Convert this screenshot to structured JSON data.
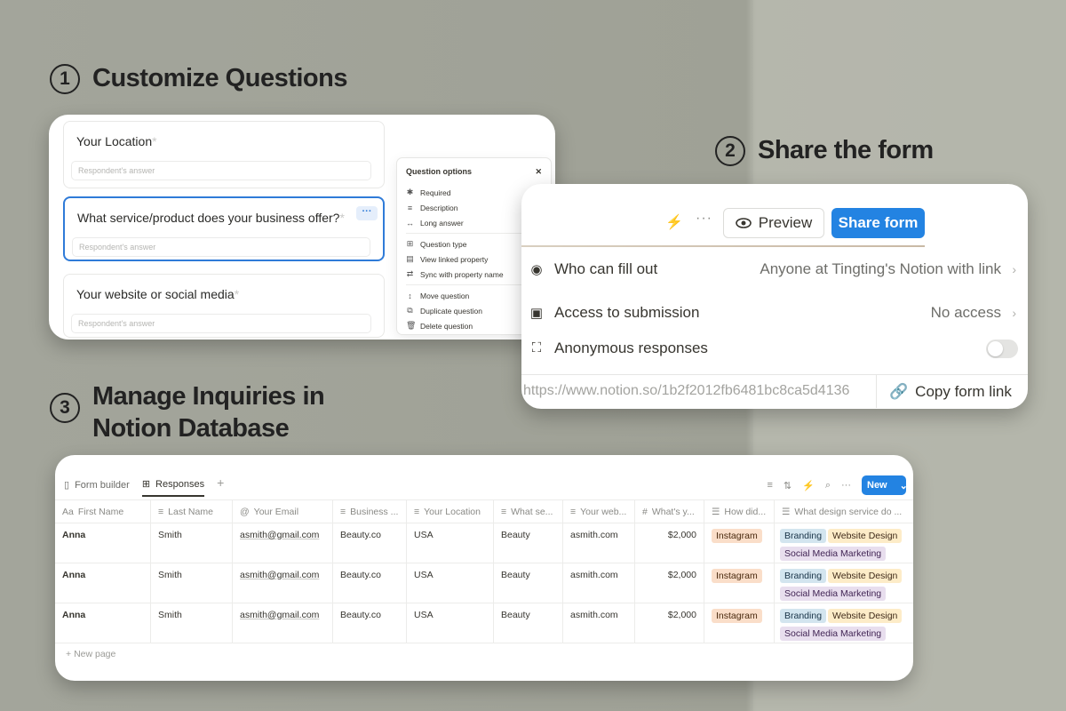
{
  "section1": {
    "num": "1",
    "title": "Customize Questions"
  },
  "section2": {
    "num": "2",
    "title": "Share the form"
  },
  "section3": {
    "num": "3",
    "title_line1": "Manage Inquiries in",
    "title_line2": "Notion Database"
  },
  "builder": {
    "questions": [
      {
        "title": "Your Location",
        "placeholder": "Respondent's answer"
      },
      {
        "title": "What service/product does your business offer?",
        "placeholder": "Respondent's answer"
      },
      {
        "title": "Your website or social media",
        "placeholder": "Respondent's answer"
      }
    ],
    "required_mark": "*",
    "options": {
      "title": "Question options",
      "items": [
        "Required",
        "Description",
        "Long answer",
        "Question type",
        "View linked property",
        "Sync with property name",
        "Move question",
        "Duplicate question",
        "Delete question"
      ]
    }
  },
  "share": {
    "preview_label": "Preview",
    "share_label": "Share form",
    "who_label": "Who can fill out",
    "who_value": "Anyone at Tingting's Notion with link",
    "access_label": "Access to submission",
    "access_value": "No access",
    "anon_label": "Anonymous responses",
    "url": "https://www.notion.so/1b2f2012fb6481bc8ca5d4136",
    "copy_label": "Copy form link"
  },
  "database": {
    "tabs": [
      "Form builder",
      "Responses"
    ],
    "new_label": "New",
    "columns": [
      "First Name",
      "Last Name",
      "Your Email",
      "Business ...",
      "Your Location",
      "What se...",
      "Your web...",
      "What's y...",
      "How did...",
      "What design service do ..."
    ],
    "rows": [
      {
        "first": "Anna",
        "last": "Smith",
        "email": "asmith@gmail.com",
        "business": "Beauty.co",
        "location": "USA",
        "service": "Beauty",
        "web": "asmith.com",
        "budget": "$2,000",
        "source": "Instagram",
        "design": [
          "Branding",
          "Website Design",
          "Social Media Marketing"
        ]
      },
      {
        "first": "Anna",
        "last": "Smith",
        "email": "asmith@gmail.com",
        "business": "Beauty.co",
        "location": "USA",
        "service": "Beauty",
        "web": "asmith.com",
        "budget": "$2,000",
        "source": "Instagram",
        "design": [
          "Branding",
          "Website Design",
          "Social Media Marketing"
        ]
      },
      {
        "first": "Anna",
        "last": "Smith",
        "email": "asmith@gmail.com",
        "business": "Beauty.co",
        "location": "USA",
        "service": "Beauty",
        "web": "asmith.com",
        "budget": "$2,000",
        "source": "Instagram",
        "design": [
          "Branding",
          "Website Design",
          "Social Media Marketing"
        ]
      }
    ],
    "new_page_label": "New page"
  },
  "colors": {
    "accent": "#2383e2",
    "background": "#a3a59b"
  }
}
